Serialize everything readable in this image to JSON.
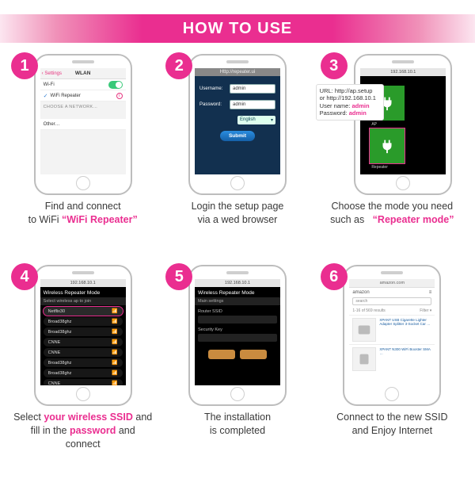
{
  "banner": {
    "title": "HOW TO USE"
  },
  "badges": [
    "1",
    "2",
    "3",
    "4",
    "5",
    "6"
  ],
  "step1": {
    "nav_back": "‹ Settings",
    "nav_title": "WLAN",
    "wifi_label": "Wi-Fi",
    "connected": "WiFi Repeater",
    "section": "Choose a network…",
    "other": "Other…",
    "caption_a": "Find and connect",
    "caption_b": "to WiFi",
    "caption_hl": "“WiFi Repeater”"
  },
  "step2": {
    "url": "Http://repeater.ui",
    "username_label": "Username:",
    "username_value": "admin",
    "password_label": "Password:",
    "password_value": "admin",
    "lang": "English",
    "submit": "Submit",
    "caption_a": "Login the setup page",
    "caption_b": "via a wed browser"
  },
  "step3": {
    "url": "192.168.10.1",
    "tile_ap": "AP",
    "tile_rp": "Repeater",
    "callout_url_label": "URL:",
    "callout_url1": "http://ap.setup",
    "callout_url2": "or http://192.168.10.1",
    "user_label": "User name:",
    "user_val": "admin",
    "pass_label": "Password:",
    "pass_val": "admin",
    "caption_a": "Choose the mode you need",
    "caption_b": "such as",
    "caption_hl": "“Repeater mode”"
  },
  "step4": {
    "url": "192.168.10.1",
    "title": "Wireless Repeater Mode",
    "sub": "Select wireless ap to join",
    "items": [
      "Netflix30",
      "Broad38ghz",
      "Broad38ghz",
      "CNNE",
      "CNNE",
      "Broad38ghz",
      "Broad38ghz",
      "CNNE"
    ],
    "caption_a": "Select",
    "caption_hl1": "your wireless SSID",
    "caption_mid": "and",
    "caption_b": "fill in the",
    "caption_hl2": "password",
    "caption_c": "and connect"
  },
  "step5": {
    "url": "192.168.10.1",
    "title": "Wireless Repeater Mode",
    "sub": "Main settings",
    "f1": "Router SSID",
    "f2": "Security Key",
    "caption_a": "The installation",
    "caption_b": "is completed"
  },
  "step6": {
    "url": "amazon.com",
    "logo": "amazon",
    "search_placeholder": "search",
    "results": "1-16 of 569 results",
    "filter": "Filter ▾",
    "prod1": "XPANT USB Cigarette Lighter Adapter Splitter 3-Socket Car …",
    "prod2": "XPANT N300 WiFi Booster SMA …",
    "caption_a": "Connect to the new SSID",
    "caption_b": "and Enjoy Internet"
  }
}
